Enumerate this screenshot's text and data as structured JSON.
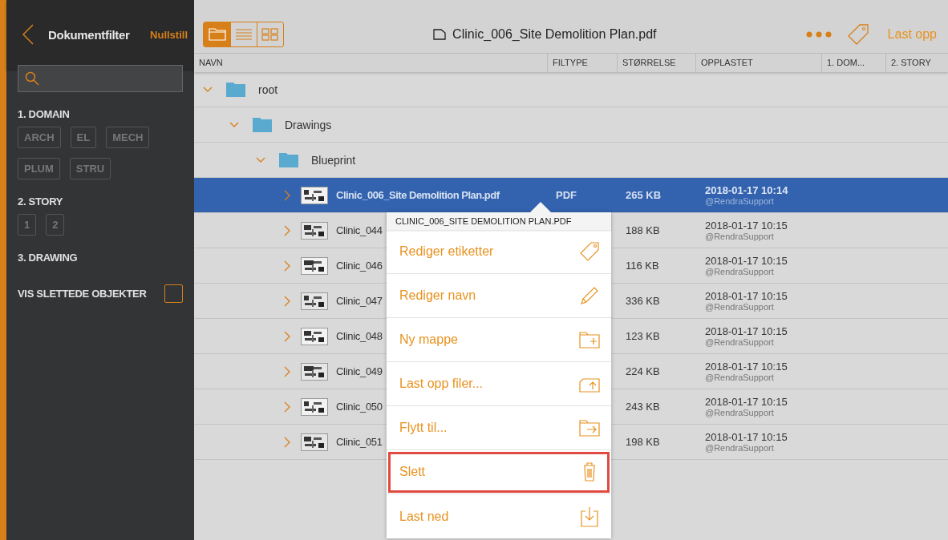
{
  "sidebar": {
    "title": "Dokumentfilter",
    "reset": "Nullstill",
    "groups": [
      {
        "title": "1. DOMAIN",
        "chips": [
          {
            "label": "ARCH",
            "selected": false
          },
          {
            "label": "EL",
            "selected": false
          },
          {
            "label": "MECH",
            "selected": false
          },
          {
            "label": "PLUM",
            "selected": false
          },
          {
            "label": "STRU",
            "selected": false
          }
        ]
      },
      {
        "title": "2. STORY",
        "chips": [
          {
            "label": "1",
            "selected": false
          },
          {
            "label": "2",
            "selected": false
          }
        ]
      },
      {
        "title": "3. DRAWING"
      }
    ],
    "show_deleted": {
      "label": "VIS SLETTEDE OBJEKTER",
      "checked": false
    }
  },
  "toolbar": {
    "views": [
      {
        "kind": "folder",
        "selected": true
      },
      {
        "kind": "list",
        "selected": false
      },
      {
        "kind": "grid",
        "selected": false
      }
    ],
    "file_title": "Clinic_006_Site Demolition Plan.pdf",
    "upload": "Last opp"
  },
  "table": {
    "columns": [
      "NAVN",
      "FILTYPE",
      "STØRRELSE",
      "OPPLASTET",
      "1. DOM...",
      "2. STORY"
    ],
    "tree": [
      {
        "kind": "folder",
        "name": "root",
        "expanded": true,
        "children": [
          {
            "kind": "folder",
            "name": "Drawings",
            "expanded": true,
            "children": [
              {
                "kind": "folder",
                "name": "Blueprint",
                "expanded": true,
                "children": [
                  {
                    "kind": "file",
                    "name": "Clinic_006_Site Demolition Plan.pdf",
                    "filetype": "PDF",
                    "size": "265 KB",
                    "uploaded": "2018-01-17 10:14",
                    "user": "@RendraSupport",
                    "selected": true
                  },
                  {
                    "kind": "file",
                    "name": "Clinic_044",
                    "size": "188 KB",
                    "uploaded": "2018-01-17 10:15",
                    "user": "@RendraSupport",
                    "selected": false
                  },
                  {
                    "kind": "file",
                    "name": "Clinic_046",
                    "size": "116 KB",
                    "uploaded": "2018-01-17 10:15",
                    "user": "@RendraSupport",
                    "selected": false
                  },
                  {
                    "kind": "file",
                    "name": "Clinic_047",
                    "size": "336 KB",
                    "uploaded": "2018-01-17 10:15",
                    "user": "@RendraSupport",
                    "selected": false
                  },
                  {
                    "kind": "file",
                    "name": "Clinic_048",
                    "size": "123 KB",
                    "uploaded": "2018-01-17 10:15",
                    "user": "@RendraSupport",
                    "selected": false
                  },
                  {
                    "kind": "file",
                    "name": "Clinic_049",
                    "size": "224 KB",
                    "uploaded": "2018-01-17 10:15",
                    "user": "@RendraSupport",
                    "selected": false
                  },
                  {
                    "kind": "file",
                    "name": "Clinic_050",
                    "size": "243 KB",
                    "uploaded": "2018-01-17 10:15",
                    "user": "@RendraSupport",
                    "selected": false
                  },
                  {
                    "kind": "file",
                    "name": "Clinic_051",
                    "size": "198 KB",
                    "uploaded": "2018-01-17 10:15",
                    "user": "@RendraSupport",
                    "selected": false
                  }
                ]
              }
            ]
          }
        ]
      }
    ]
  },
  "context_menu": {
    "title": "CLINIC_006_SITE DEMOLITION PLAN.PDF",
    "items": [
      {
        "label": "Rediger etiketter",
        "kind": "tag",
        "highlighted": false
      },
      {
        "label": "Rediger navn",
        "kind": "pencil",
        "highlighted": false
      },
      {
        "label": "Ny mappe",
        "kind": "new-folder",
        "highlighted": false
      },
      {
        "label": "Last opp filer...",
        "kind": "upload",
        "highlighted": false
      },
      {
        "label": "Flytt til...",
        "kind": "move",
        "highlighted": false
      },
      {
        "label": "Slett",
        "kind": "trash",
        "highlighted": true
      },
      {
        "label": "Last ned",
        "kind": "download",
        "highlighted": false
      }
    ]
  }
}
